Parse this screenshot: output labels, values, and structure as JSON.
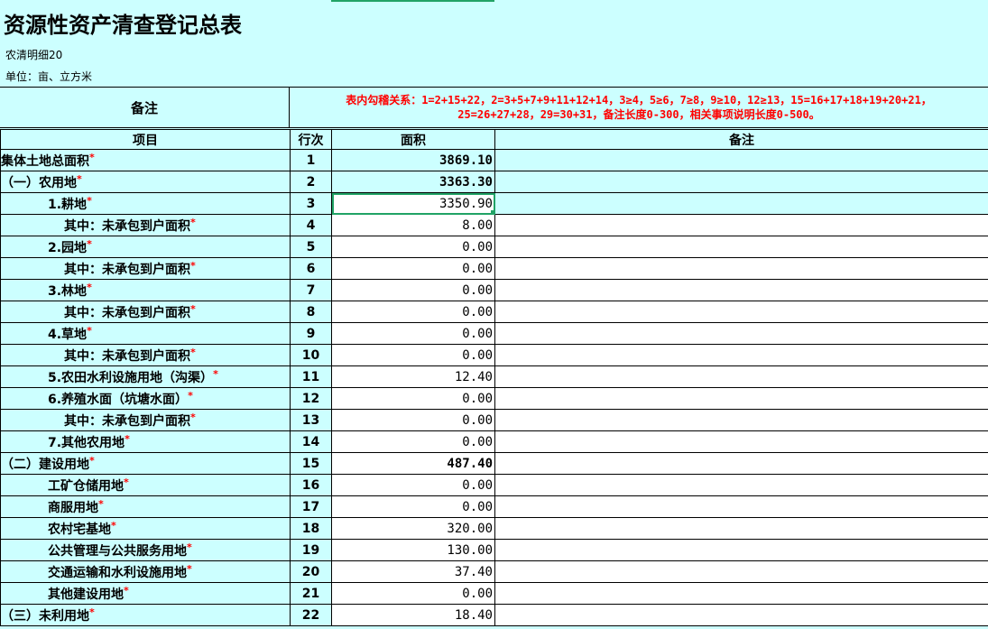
{
  "title": "资源性资产清查登记总表",
  "subtitle": "农清明细20",
  "unit": "单位：亩、立方米",
  "header": {
    "note_label": "备注",
    "rule_line1": "表内勾稽关系：1=2+15+22，2=3+5+7+9+11+12+14，3≥4，5≥6，7≥8，9≥10，12≥13，15=16+17+18+19+20+21，",
    "rule_line2": "25=26+27+28，29=30+31，备注长度0-300，相关事项说明长度0-500。"
  },
  "columns": [
    "项目",
    "行次",
    "面积",
    "备注"
  ],
  "required_mark": "*",
  "rows": [
    {
      "name": "集体土地总面积",
      "indent": 0,
      "line": "1",
      "area": "3869.10",
      "bold": true
    },
    {
      "name": "（一）农用地",
      "indent": 0,
      "line": "2",
      "area": "3363.30",
      "bold": true
    },
    {
      "name": "1.耕地",
      "indent": 52,
      "line": "3",
      "area": "3350.90",
      "bold": false,
      "selected": true
    },
    {
      "name": "其中：未承包到户面积",
      "indent": 70,
      "line": "4",
      "area": "8.00",
      "bold": false
    },
    {
      "name": "2.园地",
      "indent": 52,
      "line": "5",
      "area": "0.00",
      "bold": false
    },
    {
      "name": "其中：未承包到户面积",
      "indent": 70,
      "line": "6",
      "area": "0.00",
      "bold": false
    },
    {
      "name": "3.林地",
      "indent": 52,
      "line": "7",
      "area": "0.00",
      "bold": false
    },
    {
      "name": "其中：未承包到户面积",
      "indent": 70,
      "line": "8",
      "area": "0.00",
      "bold": false
    },
    {
      "name": "4.草地",
      "indent": 52,
      "line": "9",
      "area": "0.00",
      "bold": false
    },
    {
      "name": "其中：未承包到户面积",
      "indent": 70,
      "line": "10",
      "area": "0.00",
      "bold": false
    },
    {
      "name": "5.农田水利设施用地（沟渠）",
      "indent": 52,
      "line": "11",
      "area": "12.40",
      "bold": false
    },
    {
      "name": "6.养殖水面（坑塘水面）",
      "indent": 52,
      "line": "12",
      "area": "0.00",
      "bold": false
    },
    {
      "name": "其中：未承包到户面积",
      "indent": 70,
      "line": "13",
      "area": "0.00",
      "bold": false
    },
    {
      "name": "7.其他农用地",
      "indent": 52,
      "line": "14",
      "area": "0.00",
      "bold": false
    },
    {
      "name": "（二）建设用地",
      "indent": 0,
      "line": "15",
      "area": "487.40",
      "bold": true
    },
    {
      "name": "工矿仓储用地",
      "indent": 52,
      "line": "16",
      "area": "0.00",
      "bold": false
    },
    {
      "name": "商服用地",
      "indent": 52,
      "line": "17",
      "area": "0.00",
      "bold": false
    },
    {
      "name": "农村宅基地",
      "indent": 52,
      "line": "18",
      "area": "320.00",
      "bold": false
    },
    {
      "name": "公共管理与公共服务用地",
      "indent": 52,
      "line": "19",
      "area": "130.00",
      "bold": false
    },
    {
      "name": "交通运输和水利设施用地",
      "indent": 52,
      "line": "20",
      "area": "37.40",
      "bold": false
    },
    {
      "name": "其他建设用地",
      "indent": 52,
      "line": "21",
      "area": "0.00",
      "bold": false
    },
    {
      "name": "（三）未利用地",
      "indent": 0,
      "line": "22",
      "area": "18.40",
      "bold": false
    }
  ],
  "colors": {
    "background": "#ccffff",
    "required": "#ff0000",
    "selection": "#21a366"
  }
}
